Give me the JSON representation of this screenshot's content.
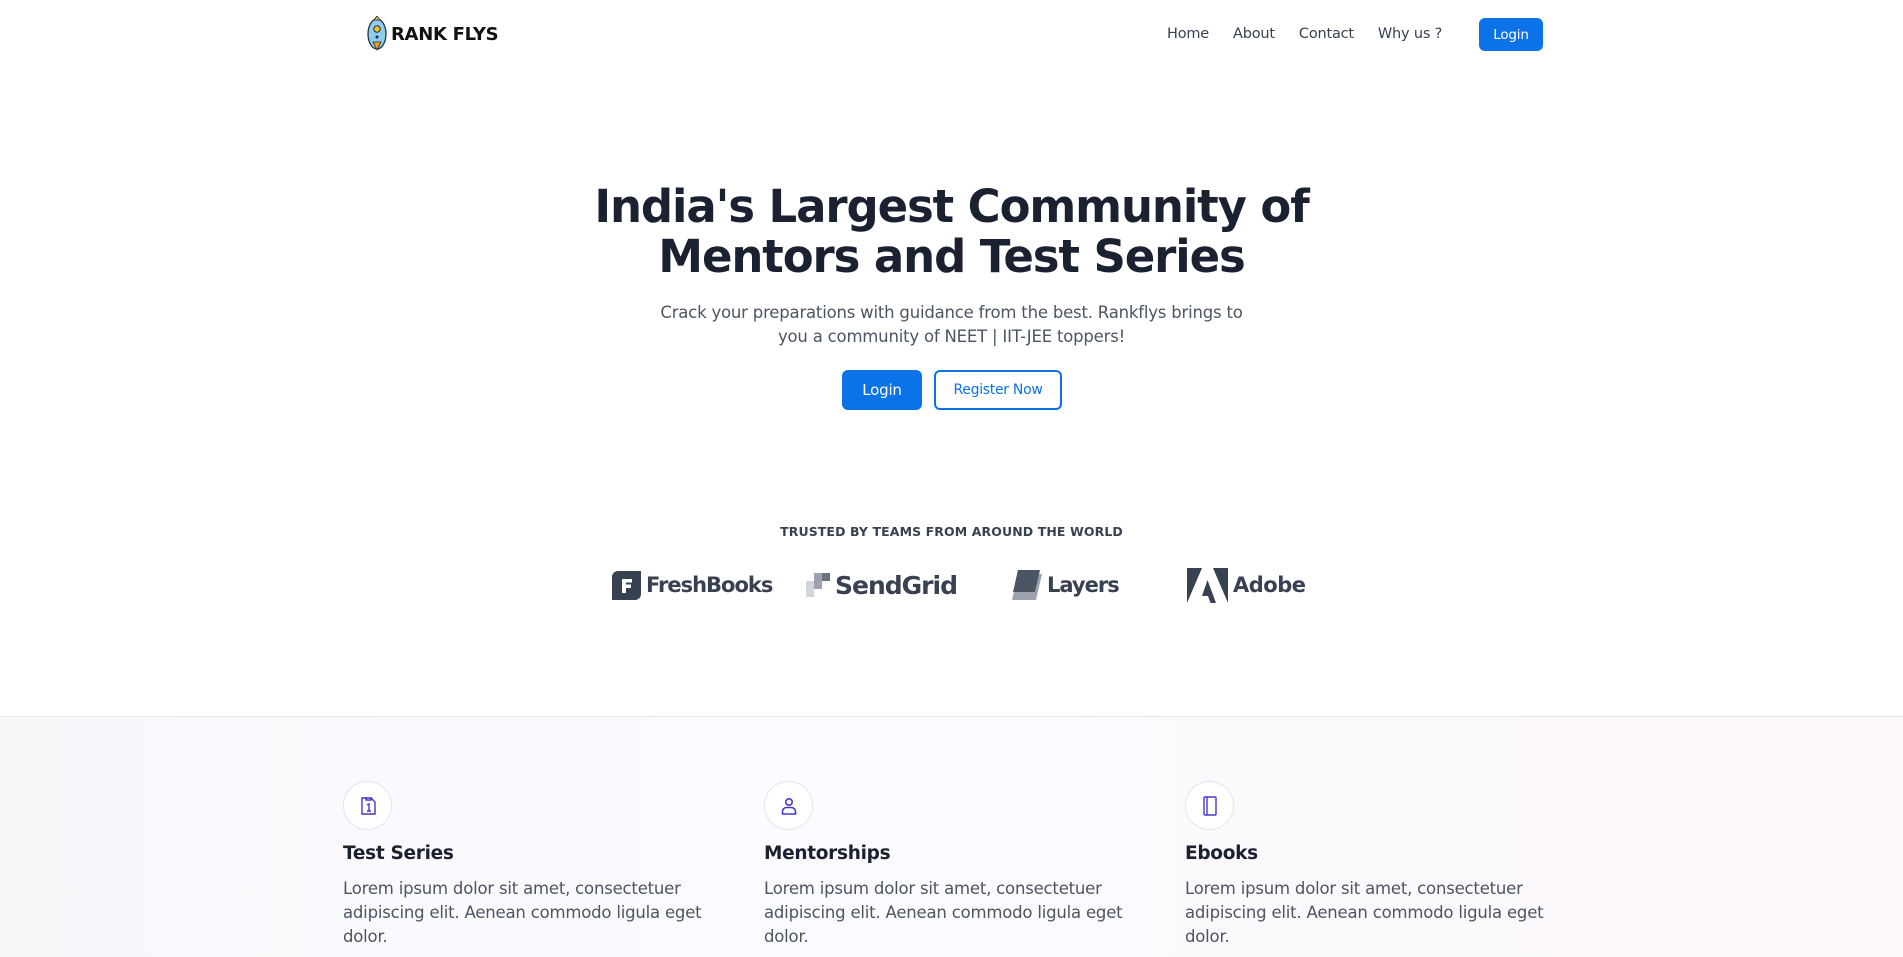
{
  "brand": {
    "name": "RANK FLYS"
  },
  "nav": {
    "links": [
      "Home",
      "About",
      "Contact",
      "Why us ?"
    ],
    "login_label": "Login"
  },
  "hero": {
    "title_line1": "India's Largest Community of",
    "title_line2": "Mentors and Test Series",
    "subtitle": "Crack your preparations with guidance from the best. Rankflys brings to you a community of NEET | IIT-JEE toppers!",
    "login_label": "Login",
    "register_label": "Register Now"
  },
  "trusted": {
    "heading": "TRUSTED BY TEAMS FROM AROUND THE WORLD",
    "logos": [
      "FreshBooks",
      "SendGrid",
      "Layers",
      "Adobe"
    ]
  },
  "features": [
    {
      "icon": "test-series-icon",
      "title": "Test Series",
      "text": "Lorem ipsum dolor sit amet, consectetuer adipiscing elit. Aenean commodo ligula eget dolor."
    },
    {
      "icon": "mentor-icon",
      "title": "Mentorships",
      "text": "Lorem ipsum dolor sit amet, consectetuer adipiscing elit. Aenean commodo ligula eget dolor."
    },
    {
      "icon": "ebook-icon",
      "title": "Ebooks",
      "text": "Lorem ipsum dolor sit amet, consectetuer adipiscing elit. Aenean commodo ligula eget dolor."
    }
  ],
  "colors": {
    "primary": "#0b72e7",
    "heading": "#1a2131",
    "body_text": "#4b5563",
    "icon_accent": "#4338ca"
  }
}
